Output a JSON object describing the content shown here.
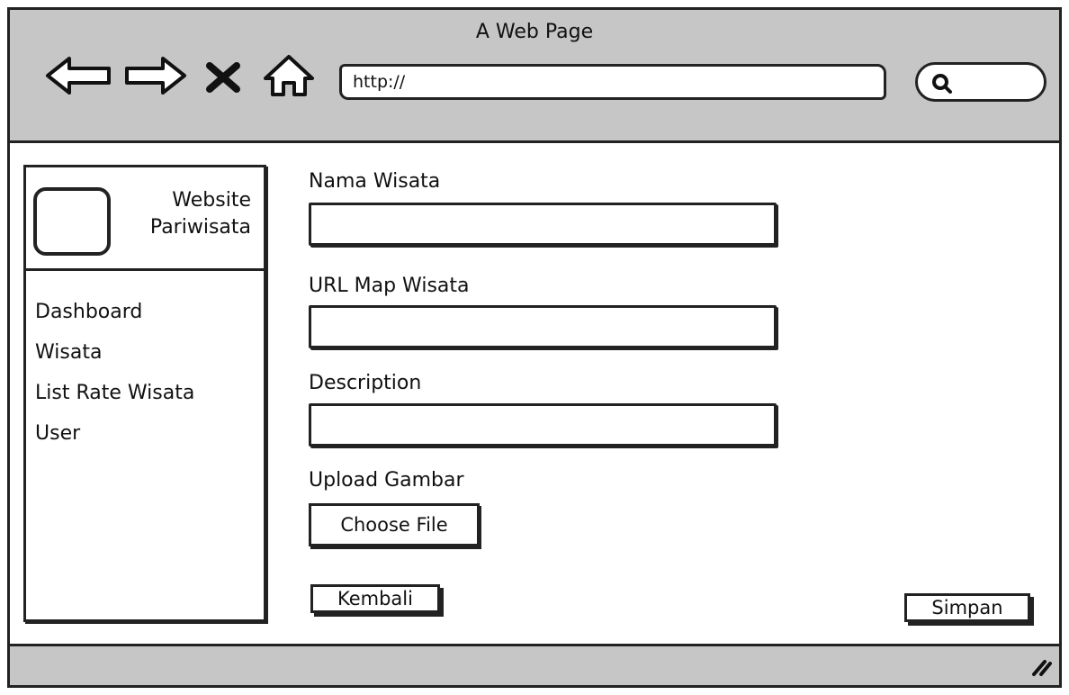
{
  "window": {
    "title": "A Web Page",
    "url": "http://"
  },
  "nav": {
    "back_icon": "arrow-left-icon",
    "forward_icon": "arrow-right-icon",
    "stop_icon": "close-icon",
    "home_icon": "home-icon",
    "search_icon": "search-icon"
  },
  "sidebar": {
    "brand_line1": "Website",
    "brand_line2": "Pariwisata",
    "items": [
      {
        "label": "Dashboard"
      },
      {
        "label": "Wisata"
      },
      {
        "label": "List Rate Wisata"
      },
      {
        "label": "User"
      }
    ]
  },
  "form": {
    "nama_label": "Nama Wisata",
    "url_label": "URL Map Wisata",
    "description_label": "Description",
    "upload_label": "Upload Gambar",
    "choose_file_label": "Choose File"
  },
  "actions": {
    "back_label": "Kembali",
    "save_label": "Simpan"
  }
}
